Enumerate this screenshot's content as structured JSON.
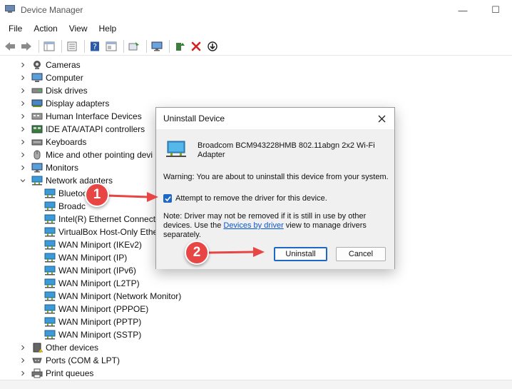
{
  "window": {
    "title": "Device Manager",
    "minimize": "—",
    "maximize": "☐",
    "close": "✕"
  },
  "menu": [
    "File",
    "Action",
    "View",
    "Help"
  ],
  "tree": {
    "top_items": [
      {
        "label": "Cameras",
        "icon": "camera-icon"
      },
      {
        "label": "Computer",
        "icon": "computer-icon"
      },
      {
        "label": "Disk drives",
        "icon": "disk-drive-icon"
      },
      {
        "label": "Display adapters",
        "icon": "display-adapter-icon"
      },
      {
        "label": "Human Interface Devices",
        "icon": "hid-icon"
      },
      {
        "label": "IDE ATA/ATAPI controllers",
        "icon": "ide-controller-icon"
      },
      {
        "label": "Keyboards",
        "icon": "keyboard-icon"
      },
      {
        "label": "Mice and other pointing devi",
        "icon": "mouse-icon"
      },
      {
        "label": "Monitors",
        "icon": "monitor-icon"
      },
      {
        "label": "Network adapters",
        "icon": "network-adapter-icon"
      }
    ],
    "network_children": [
      "Bluetoo",
      "Broadc",
      "Intel(R) Ethernet Connecti",
      "VirtualBox Host-Only Ethe",
      "WAN Miniport (IKEv2)",
      "WAN Miniport (IP)",
      "WAN Miniport (IPv6)",
      "WAN Miniport (L2TP)",
      "WAN Miniport (Network Monitor)",
      "WAN Miniport (PPPOE)",
      "WAN Miniport (PPTP)",
      "WAN Miniport (SSTP)"
    ],
    "bottom_items": [
      {
        "label": "Other devices",
        "icon": "other-devices-icon"
      },
      {
        "label": "Ports (COM & LPT)",
        "icon": "ports-icon"
      },
      {
        "label": "Print queues",
        "icon": "printer-icon"
      }
    ]
  },
  "dialog": {
    "title": "Uninstall Device",
    "device_name": "Broadcom BCM943228HMB 802.11abgn 2x2 Wi-Fi Adapter",
    "warning": "Warning: You are about to uninstall this device from your system.",
    "checkbox_label": "Attempt to remove the driver for this device.",
    "checkbox_checked": true,
    "note_prefix": "Note: Driver may not be removed if it is still in use by other devices. Use the ",
    "note_link": "Devices by driver",
    "note_suffix": " view to manage drivers separately.",
    "uninstall_label": "Uninstall",
    "cancel_label": "Cancel"
  },
  "annotations": {
    "step1": "1",
    "step2": "2"
  },
  "colors": {
    "accent": "#1d68c7",
    "badge": "#e84545",
    "link": "#0b57d0"
  }
}
